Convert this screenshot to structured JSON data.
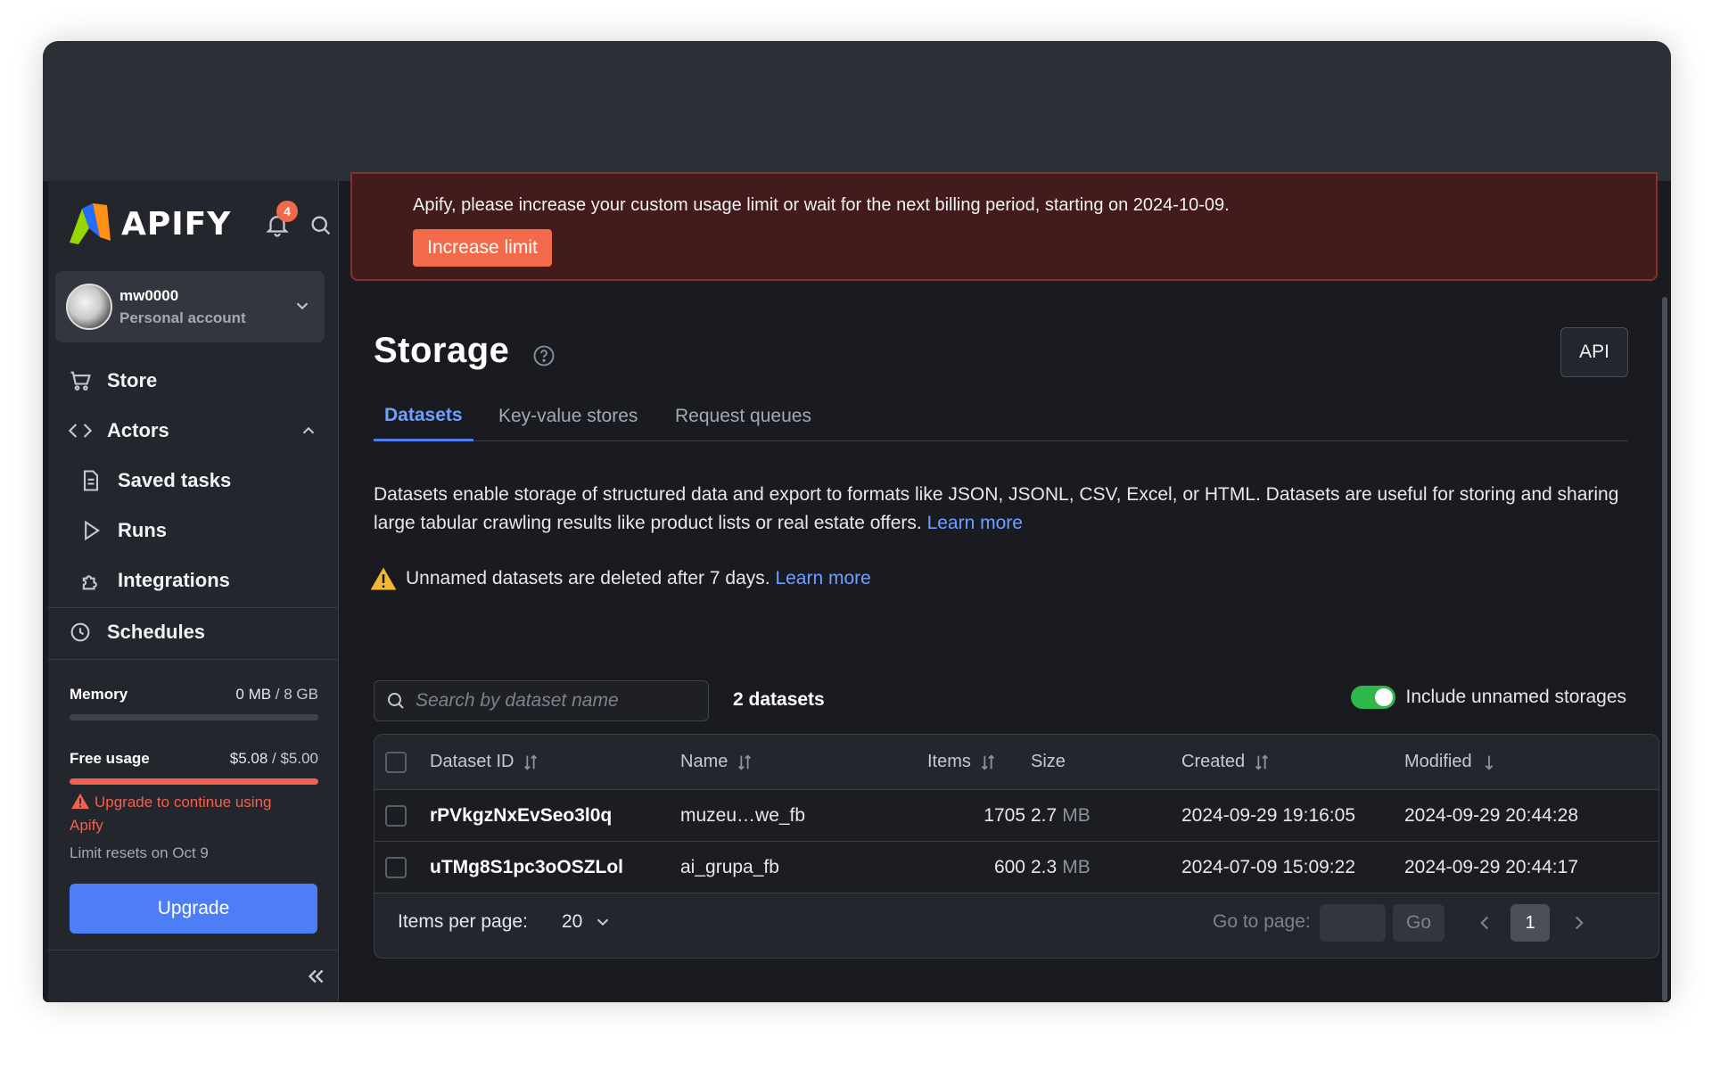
{
  "brand": {
    "name": "APIFY",
    "notifications": "4"
  },
  "account": {
    "username": "mw0000",
    "type": "Personal account"
  },
  "nav": {
    "store": "Store",
    "actors": "Actors",
    "saved_tasks": "Saved tasks",
    "runs": "Runs",
    "integrations": "Integrations",
    "schedules": "Schedules"
  },
  "usage": {
    "memory_label": "Memory",
    "memory_used": "0 MB",
    "memory_total": " / 8 GB",
    "memory_fraction": 0,
    "free_label": "Free usage",
    "free_used": "$5.08",
    "free_total": " / $5.00",
    "free_fraction": 1.0,
    "warning": "Upgrade to continue using Apify",
    "resets": "Limit resets on Oct 9",
    "upgrade_button": "Upgrade"
  },
  "alert": {
    "text": "Apify, please increase your custom usage limit or wait for the next billing period, starting on 2024-10-09.",
    "button": "Increase limit"
  },
  "page": {
    "title": "Storage",
    "api_button": "API",
    "tabs": [
      "Datasets",
      "Key-value stores",
      "Request queues"
    ],
    "description": "Datasets enable storage of structured data and export to formats like JSON, JSONL, CSV, Excel, or HTML. Datasets are useful for storing and sharing large tabular crawling results like product lists or real estate offers.",
    "learn_more": "Learn more",
    "notice": "Unnamed datasets are deleted after 7 days.",
    "notice_link": "Learn more"
  },
  "toolbar": {
    "search_placeholder": "Search by dataset name",
    "count": "2 datasets",
    "toggle_label": "Include unnamed storages",
    "toggle_on": true
  },
  "table": {
    "headers": [
      "Dataset ID",
      "Name",
      "Items",
      "Size",
      "Created",
      "Modified"
    ],
    "rows": [
      {
        "id": "rPVkgzNxEvSeo3l0q",
        "name": "muzeu…we_fb",
        "items": "1705",
        "size": "2.7",
        "unit": "MB",
        "created": "2024-09-29 19:16:05",
        "modified": "2024-09-29 20:44:28"
      },
      {
        "id": "uTMg8S1pc3oOSZLol",
        "name": "ai_grupa_fb",
        "items": "600",
        "size": "2.3",
        "unit": "MB",
        "created": "2024-07-09 15:09:22",
        "modified": "2024-09-29 20:44:17"
      }
    ]
  },
  "pagination": {
    "items_per_page_label": "Items per page:",
    "items_per_page": "20",
    "goto_label": "Go to page:",
    "go_button": "Go",
    "current_page": "1"
  },
  "colors": {
    "accent": "#4d7ef7",
    "danger": "#f36a4a",
    "success": "#2eb84b"
  }
}
